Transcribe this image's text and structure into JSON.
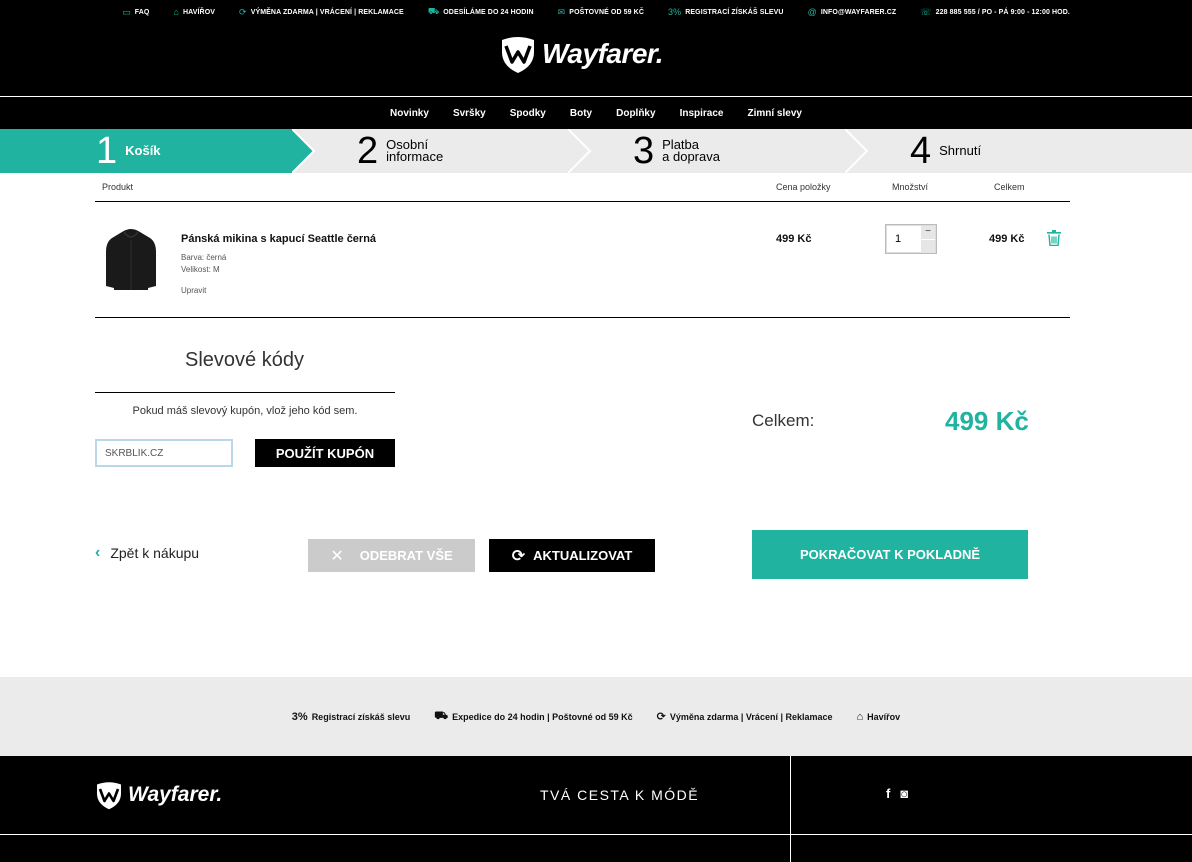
{
  "topbar": {
    "items": [
      {
        "icon": "chat-icon",
        "glyph": "▭",
        "label": "FAQ"
      },
      {
        "icon": "home-icon",
        "glyph": "⌂",
        "label": "HAVÍŘOV"
      },
      {
        "icon": "refresh-icon",
        "glyph": "⟳",
        "label": "VÝMĚNA ZDARMA | VRÁCENÍ | REKLAMACE"
      },
      {
        "icon": "truck-icon",
        "glyph": "⛟",
        "label": "ODESÍLÁME DO 24 HODIN"
      },
      {
        "icon": "envelope-icon",
        "glyph": "✉",
        "label": "POŠTOVNÉ OD 59 KČ"
      },
      {
        "icon": "percent-icon",
        "glyph": "3%",
        "label": "REGISTRACÍ ZÍSKÁŠ SLEVU"
      },
      {
        "icon": "at-icon",
        "glyph": "@",
        "label": "INFO@WAYFARER.CZ"
      },
      {
        "icon": "phone-icon",
        "glyph": "☏",
        "label": "228 885 555 / PO - PÁ 9:00 - 12:00 HOD."
      }
    ]
  },
  "brand": {
    "name": "Wayfarer."
  },
  "nav": [
    "Novinky",
    "Svršky",
    "Spodky",
    "Boty",
    "Doplňky",
    "Inspirace",
    "Zimní slevy"
  ],
  "steps": [
    {
      "num": "1",
      "label": "Košík",
      "label2": ""
    },
    {
      "num": "2",
      "label": "Osobní",
      "label2": "informace"
    },
    {
      "num": "3",
      "label": "Platba",
      "label2": "a doprava"
    },
    {
      "num": "4",
      "label": "Shrnutí",
      "label2": ""
    }
  ],
  "cart": {
    "headers": {
      "product": "Produkt",
      "price": "Cena položky",
      "qty": "Množství",
      "total": "Celkem"
    },
    "item": {
      "name": "Pánská mikina s kapucí Seattle černá",
      "color_label": "Barva:",
      "color": "černá",
      "size_label": "Velikost:",
      "size": "M",
      "edit": "Upravit",
      "price": "499 Kč",
      "qty": "1",
      "total": "499 Kč"
    }
  },
  "discount": {
    "title": "Slevové kódy",
    "text": "Pokud máš slevový kupón, vlož jeho kód sem.",
    "input_value": "SKRBLÍK.CZ",
    "button": "POUŽÍT KUPÓN"
  },
  "summary": {
    "label": "Celkem:",
    "value": "499 Kč"
  },
  "actions": {
    "back": "Zpět k nákupu",
    "remove_all": "ODEBRAT VŠE",
    "update": "AKTUALIZOVAT",
    "checkout": "POKRAČOVAT K POKLADNĚ"
  },
  "benefits": [
    {
      "icon": "percent-icon",
      "glyph": "3%",
      "label": "Registrací získáš slevu"
    },
    {
      "icon": "truck-icon",
      "glyph": "⛟",
      "label": "Expedice do 24 hodin | Poštovné od 59 Kč"
    },
    {
      "icon": "refresh-icon",
      "glyph": "⟳",
      "label": "Výměna zdarma | Vrácení | Reklamace"
    },
    {
      "icon": "home-icon",
      "glyph": "⌂",
      "label": "Havířov"
    }
  ],
  "footer": {
    "slogan": "TVÁ CESTA K MÓDĚ",
    "social": [
      {
        "icon": "facebook-icon",
        "glyph": "f"
      },
      {
        "icon": "instagram-icon",
        "glyph": "◙"
      }
    ]
  },
  "colors": {
    "accent": "#1fb3a0",
    "dark": "#000000",
    "light_gray": "#ebebec",
    "disabled": "#cbcbcb"
  }
}
